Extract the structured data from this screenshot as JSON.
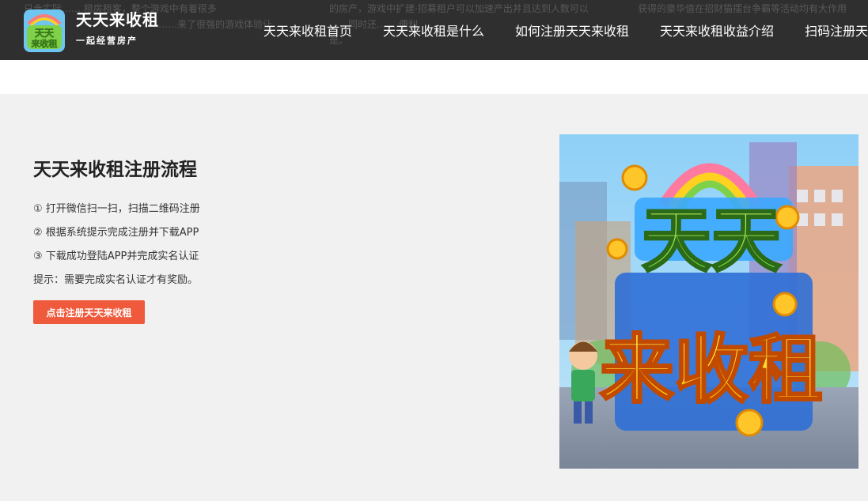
{
  "header": {
    "title": "天天来收租",
    "slogan": "一起经营房产",
    "bg_text_lines": [
      "日合实际…… 租房租客，整个游戏中有着很多",
      "……来了很强的游戏体验让…",
      "的房产，游戏中扩建·招募租户可以加速产出并且达到人数可以",
      "…，同时还…… 便利…",
      "是。",
      "获得的豪华值在招财猫擂台争霸等活动均有大作用"
    ],
    "logo_text": "天天来收租"
  },
  "nav": {
    "items": [
      "天天来收租首页",
      "天天来收租是什么",
      "如何注册天天来收租",
      "天天来收租收益介绍",
      "扫码注册天"
    ]
  },
  "main": {
    "title": "天天来收租注册流程",
    "steps": [
      "① 打开微信扫一扫，扫描二维码注册",
      "② 根据系统提示完成注册并下载APP",
      "③ 下载成功登陆APP并完成实名认证"
    ],
    "tip": "提示：需要完成实名认证才有奖励。",
    "cta_label": "点击注册天天来收租"
  },
  "hero": {
    "logo_line1": "天天",
    "logo_line2": "来收租"
  },
  "colors": {
    "header_bg": "#2f2f2f",
    "section_bg": "#f1f1f1",
    "cta_bg": "#f05a3c",
    "logo_yellow": "#ffd21f",
    "logo_green": "#8ee04a"
  }
}
